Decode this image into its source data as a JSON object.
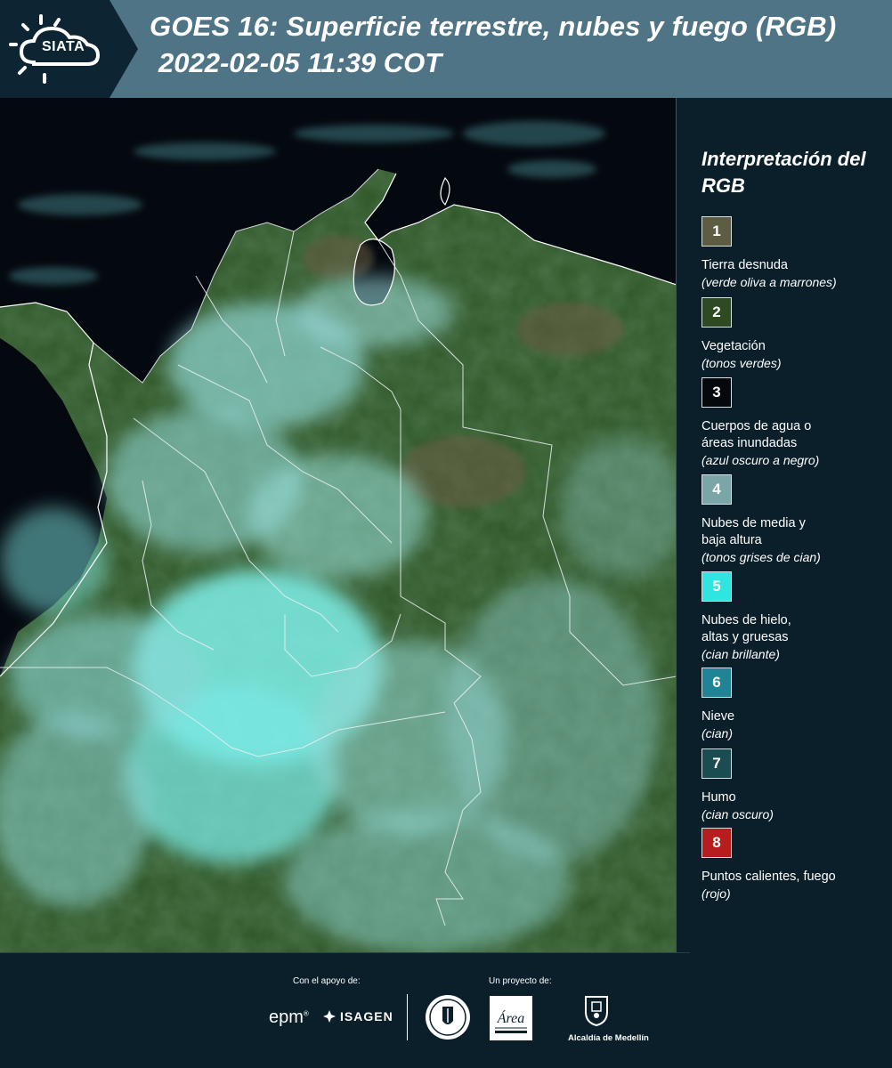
{
  "header": {
    "logo_text": "SIATA",
    "title": "GOES 16: Superficie terrestre, nubes y fuego (RGB)",
    "datetime": "2022-02-05 11:39 COT",
    "colors": {
      "header_bg": "#4e7485",
      "logo_tab_bg": "#0d2533"
    }
  },
  "map": {
    "description_icon": "satellite-rgb-map",
    "colors": {
      "ocean": "#050a12",
      "vegetation": "#2f5a2a",
      "bare_land": "#5a5a3c",
      "cloud": "#7ee8e4",
      "border": "#e6eef0"
    }
  },
  "legend": {
    "title": "Interpretación del RGB",
    "items": [
      {
        "number": "1",
        "label": "Tierra desnuda",
        "desc": "(verde oliva a marrones)",
        "color": "#5f5c44",
        "text_color": "#ffffff"
      },
      {
        "number": "2",
        "label": "Vegetación",
        "desc": "(tonos verdes)",
        "color": "#2e4a22",
        "text_color": "#ffffff"
      },
      {
        "number": "3",
        "label": "Cuerpos de agua o\náreas inundadas",
        "desc": "(azul oscuro a negro)",
        "color": "#05080c",
        "text_color": "#ffffff"
      },
      {
        "number": "4",
        "label": "Nubes de media y\nbaja altura",
        "desc": "(tonos grises de cian)",
        "color": "#7aa6a8",
        "text_color": "#ffffff"
      },
      {
        "number": "5",
        "label": "Nubes de hielo,\naltas y gruesas",
        "desc": "(cian brillante)",
        "color": "#2ee5e0",
        "text_color": "#ffffff"
      },
      {
        "number": "6",
        "label": "Nieve",
        "desc": "(cian)",
        "color": "#1f8596",
        "text_color": "#ffffff"
      },
      {
        "number": "7",
        "label": "Humo",
        "desc": "(cian oscuro)",
        "color": "#1b4c52",
        "text_color": "#ffffff"
      },
      {
        "number": "8",
        "label": "Puntos calientes, fuego",
        "desc": "(rojo)",
        "color": "#b81d1d",
        "text_color": "#ffffff"
      }
    ]
  },
  "footer": {
    "support_label": "Con el apoyo de:",
    "project_label": "Un proyecto de:",
    "epm": "epm",
    "isagen": "ISAGEN",
    "alcaldia": "Alcaldía de Medellín",
    "area_logo_text": "Área"
  }
}
